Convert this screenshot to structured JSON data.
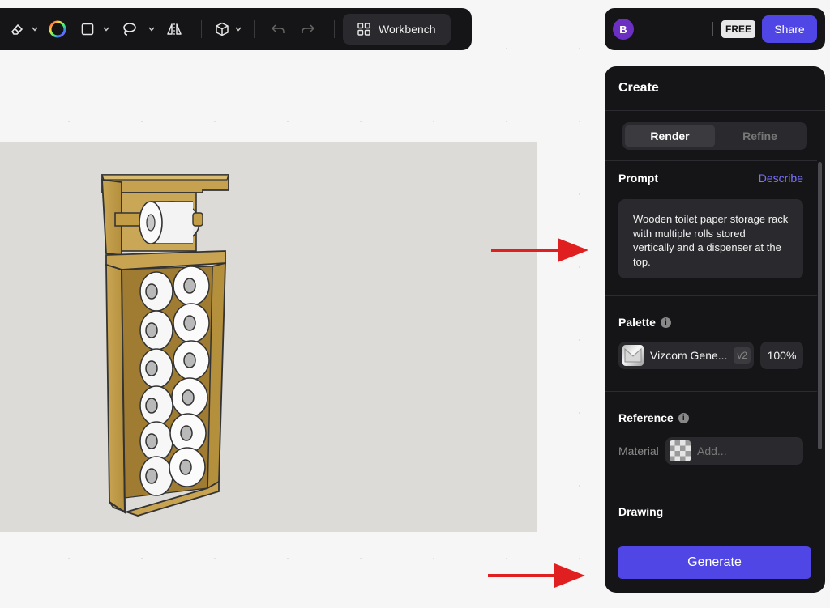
{
  "toolbar": {
    "tools": [
      {
        "name": "eraser-icon"
      },
      {
        "name": "color-wheel-icon"
      },
      {
        "name": "rectangle-icon"
      },
      {
        "name": "lasso-icon"
      },
      {
        "name": "mirror-icon"
      },
      {
        "name": "3d-cube-icon"
      },
      {
        "name": "undo-icon"
      },
      {
        "name": "redo-icon"
      }
    ],
    "workbench_label": "Workbench"
  },
  "topbar": {
    "avatar_initial": "B",
    "plan_badge": "FREE",
    "share_label": "Share"
  },
  "panel": {
    "title": "Create",
    "tabs": [
      {
        "label": "Render",
        "active": true
      },
      {
        "label": "Refine",
        "active": false
      }
    ],
    "prompt": {
      "label": "Prompt",
      "describe_label": "Describe",
      "text": "Wooden toilet paper storage rack with multiple rolls stored vertically and a dispenser at the top."
    },
    "palette": {
      "label": "Palette",
      "name": "Vizcom Gene...",
      "version": "v2",
      "strength": "100%"
    },
    "reference": {
      "label": "Reference",
      "material_label": "Material",
      "material_placeholder": "Add..."
    },
    "drawing_label": "Drawing",
    "generate_label": "Generate"
  },
  "colors": {
    "accent": "#5046e5",
    "panel_bg": "#151517",
    "arrow": "#e02020"
  }
}
